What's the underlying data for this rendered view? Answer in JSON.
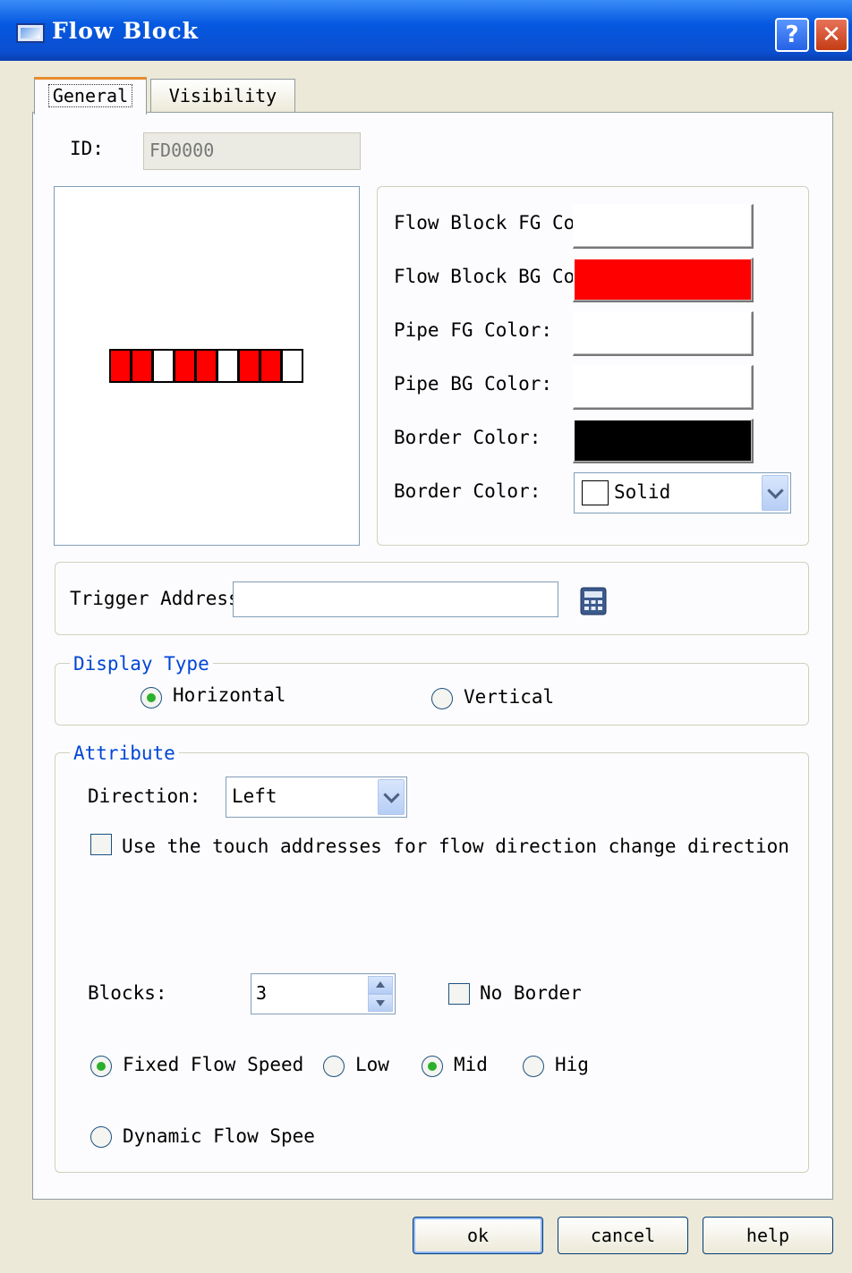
{
  "window": {
    "title": "Flow Block"
  },
  "tabs": [
    {
      "label": "General"
    },
    {
      "label": "Visibility"
    }
  ],
  "id_field": {
    "label": "ID:",
    "value": "FD0000"
  },
  "preview": {
    "cells": [
      "red",
      "red",
      "white",
      "red",
      "red",
      "white",
      "red",
      "red",
      "white"
    ]
  },
  "colors": {
    "fg_label": "Flow Block FG Col",
    "bg_label": "Flow Block BG Col",
    "pipe_fg_label": "Pipe FG Color:",
    "pipe_bg_label": "Pipe BG Color:",
    "border_color_label": "Border Color:",
    "border_style_label": "Border Color:",
    "fg_value": "#ffffff",
    "bg_value": "#ff0000",
    "pipe_fg_value": "#ffffff",
    "pipe_bg_value": "#ffffff",
    "border_value": "#000000",
    "border_style": "Solid"
  },
  "trigger": {
    "label": "Trigger Address",
    "value": ""
  },
  "display_type": {
    "title": "Display Type",
    "horizontal": "Horizontal",
    "vertical": "Vertical",
    "selected": "horizontal"
  },
  "attribute": {
    "title": "Attribute",
    "direction_label": "Direction:",
    "direction_value": "Left",
    "touch_label": "Use the touch addresses for flow direction change direction",
    "blocks_label": "Blocks:",
    "blocks_value": "3",
    "no_border_label": "No Border",
    "fixed_label": "Fixed Flow Speed",
    "low_label": "Low",
    "mid_label": "Mid",
    "high_label": "Hig",
    "dynamic_label": "Dynamic Flow Spee"
  },
  "buttons": {
    "ok": "ok",
    "cancel": "cancel",
    "help": "help"
  }
}
